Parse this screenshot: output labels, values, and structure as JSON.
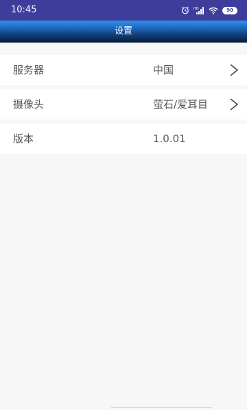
{
  "status_bar": {
    "time": "10:45",
    "icons": [
      "alarm-icon",
      "hd-signal-icon",
      "wifi-icon",
      "battery-icon"
    ],
    "battery_level": "90"
  },
  "header": {
    "title": "设置"
  },
  "settings": {
    "items": [
      {
        "label": "服务器",
        "value": "中国",
        "icon": "chevron-right-icon"
      },
      {
        "label": "摄像头",
        "value": "萤石/爱耳目",
        "icon": "chevron-right-icon"
      },
      {
        "label": "版本",
        "value": "1.0.01"
      }
    ]
  },
  "colors": {
    "status_bar": "#3f3d9c",
    "title_bar_top": "#2f95ef",
    "title_bar_bottom": "#061a38",
    "page_background": "#f7f7f7",
    "row_background": "#ffffff",
    "text": "#555555"
  }
}
